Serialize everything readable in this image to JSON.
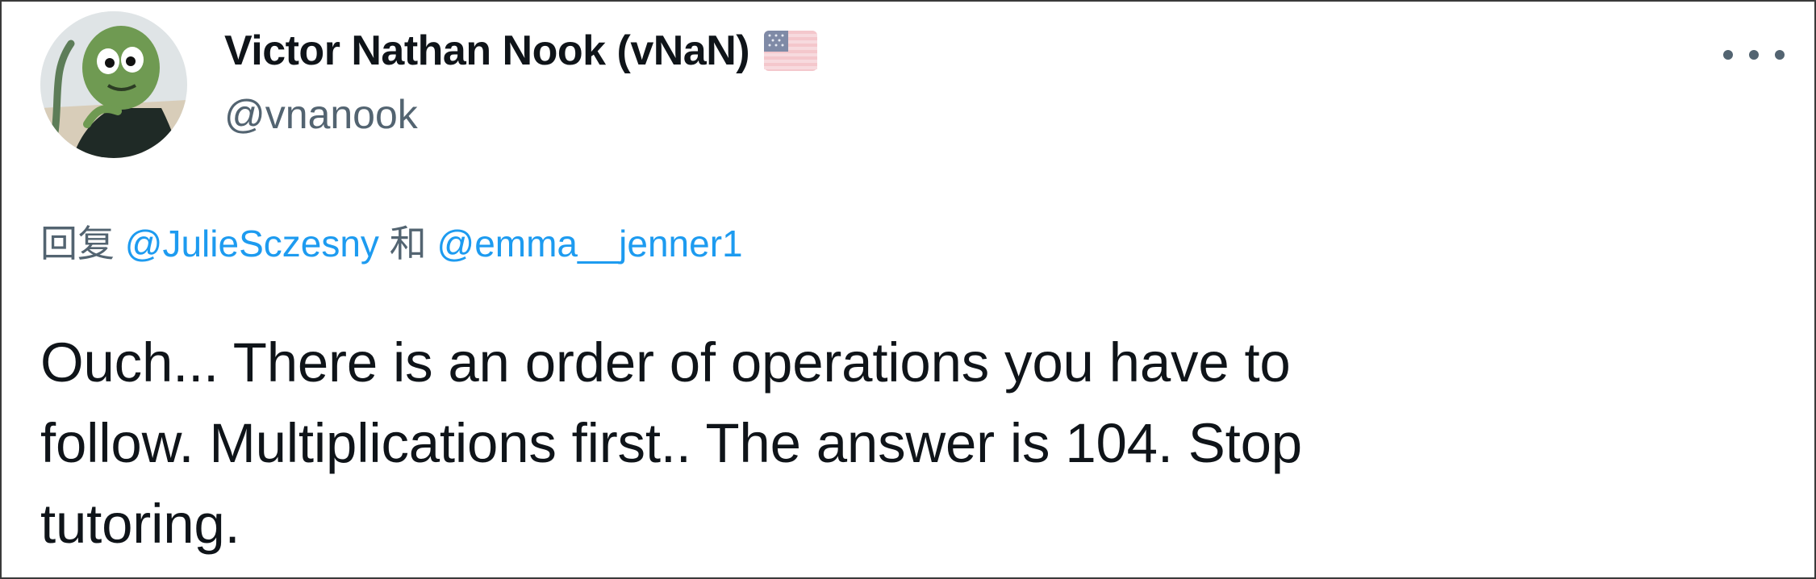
{
  "author": {
    "display_name": "Victor Nathan Nook (vNaN)",
    "handle": "@vnanook",
    "flag_icon": "us-flag-icon",
    "avatar_icon": "cartoon-green-creature-avatar"
  },
  "menu": {
    "more_icon": "more-horizontal-icon"
  },
  "reply_context": {
    "prefix": "回复",
    "mention_1": "@JulieSczesny",
    "joiner": "和",
    "mention_2": "@emma__jenner1"
  },
  "tweet": {
    "text": "Ouch... There is an order of operations you have to\nfollow. Multiplications first.. The answer is 104. Stop\ntutoring."
  },
  "colors": {
    "text_primary": "#0f1419",
    "text_secondary": "#536471",
    "link": "#1d9bf0",
    "border": "#3a3a3a"
  }
}
